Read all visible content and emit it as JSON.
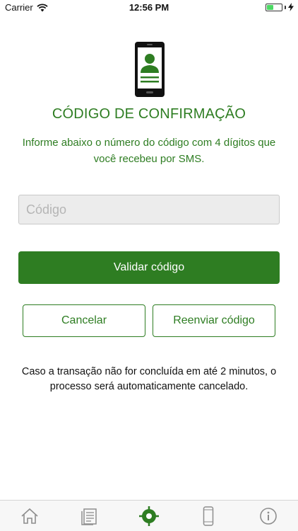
{
  "status_bar": {
    "carrier": "Carrier",
    "time": "12:56 PM",
    "battery_level": 0.45
  },
  "header": {
    "icon": "phone-user-icon",
    "title": "CÓDIGO DE CONFIRMAÇÃO",
    "subtitle": "Informe abaixo o número do código com 4 dígitos que você recebeu por SMS."
  },
  "form": {
    "code_placeholder": "Código",
    "code_value": "",
    "validate_label": "Validar código",
    "cancel_label": "Cancelar",
    "resend_label": "Reenviar código"
  },
  "notice": "Caso a transação não for concluída em até 2 minutos, o processo será automaticamente cancelado.",
  "tab_bar": {
    "tabs": [
      {
        "icon": "home-icon",
        "active": false
      },
      {
        "icon": "document-icon",
        "active": false
      },
      {
        "icon": "target-icon",
        "active": true
      },
      {
        "icon": "phone-icon",
        "active": false
      },
      {
        "icon": "info-icon",
        "active": false
      }
    ]
  },
  "colors": {
    "accent": "#2e7d22",
    "battery": "#4cd964",
    "tab_inactive": "#8e8e8e"
  }
}
